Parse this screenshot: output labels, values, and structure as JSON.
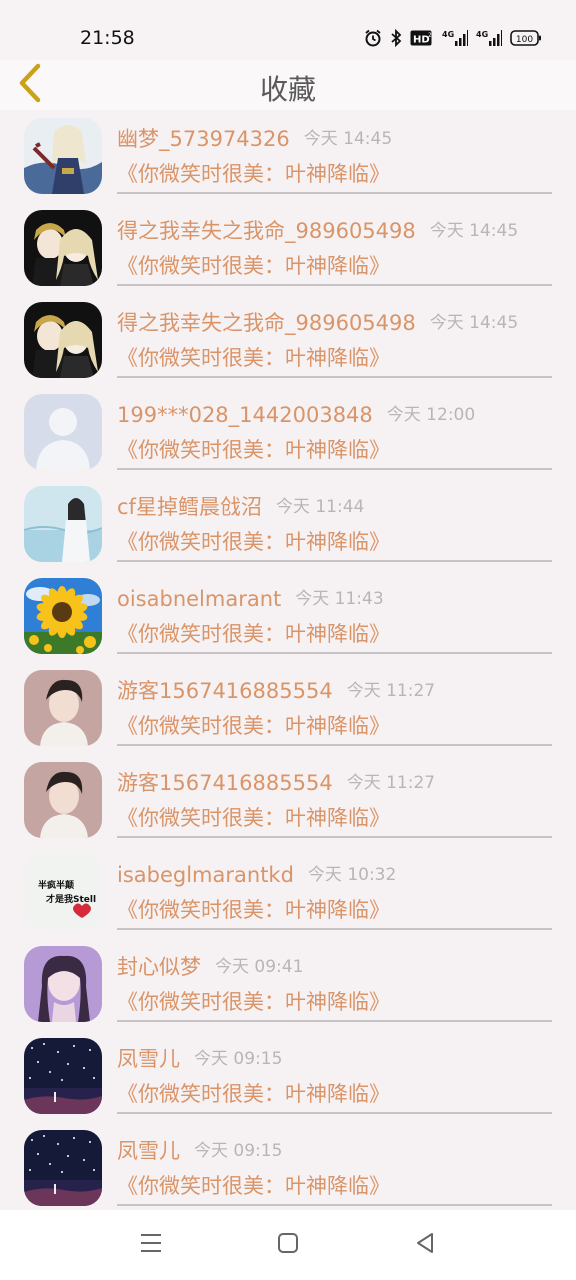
{
  "status_bar": {
    "time": "21:58",
    "battery": "100",
    "icons": [
      "alarm-icon",
      "bluetooth-icon",
      "hd-icon",
      "signal-4g-icon",
      "signal-4g-icon",
      "battery-icon"
    ]
  },
  "header": {
    "title": "收藏",
    "back_icon": "chevron-left-icon"
  },
  "colors": {
    "accent": "#d99468",
    "muted": "#b9b5b6",
    "back_arrow": "#c9a21a"
  },
  "favorites": [
    {
      "username": "幽梦_573974326",
      "time": "今天 14:45",
      "book": "《你微笑时很美：叶神降临》",
      "avatar": "anime-warrior"
    },
    {
      "username": "得之我幸失之我命_989605498",
      "time": "今天 14:45",
      "book": "《你微笑时很美：叶神降临》",
      "avatar": "anime-couple"
    },
    {
      "username": "得之我幸失之我命_989605498",
      "time": "今天 14:45",
      "book": "《你微笑时很美：叶神降临》",
      "avatar": "anime-couple"
    },
    {
      "username": "199***028_1442003848",
      "time": "今天 12:00",
      "book": "《你微笑时很美：叶神降临》",
      "avatar": "default-person"
    },
    {
      "username": "cf星掉鳕晨戗沼",
      "time": "今天 11:44",
      "book": "《你微笑时很美：叶神降临》",
      "avatar": "lake-girl"
    },
    {
      "username": "oisabnelmarant",
      "time": "今天 11:43",
      "book": "《你微笑时很美：叶神降临》",
      "avatar": "sunflower"
    },
    {
      "username": "游客1567416885554",
      "time": "今天 11:27",
      "book": "《你微笑时很美：叶神降临》",
      "avatar": "young-man"
    },
    {
      "username": "游客1567416885554",
      "time": "今天 11:27",
      "book": "《你微笑时很美：叶神降临》",
      "avatar": "young-man"
    },
    {
      "username": "isabeglmarantkd",
      "time": "今天 10:32",
      "book": "《你微笑时很美：叶神降临》",
      "avatar": "text-heart",
      "avatar_text": [
        "半疯半颠",
        "才是我Stell"
      ]
    },
    {
      "username": "封心似梦",
      "time": "今天 09:41",
      "book": "《你微笑时很美：叶神降临》",
      "avatar": "purple-girl"
    },
    {
      "username": "凤雪儿",
      "time": "今天 09:15",
      "book": "《你微笑时很美：叶神降临》",
      "avatar": "night-sky"
    },
    {
      "username": "凤雪儿",
      "time": "今天 09:15",
      "book": "《你微笑时很美：叶神降临》",
      "avatar": "night-sky"
    }
  ],
  "nav_bar": {
    "buttons": [
      "menu-icon",
      "home-square-icon",
      "back-triangle-icon"
    ]
  }
}
